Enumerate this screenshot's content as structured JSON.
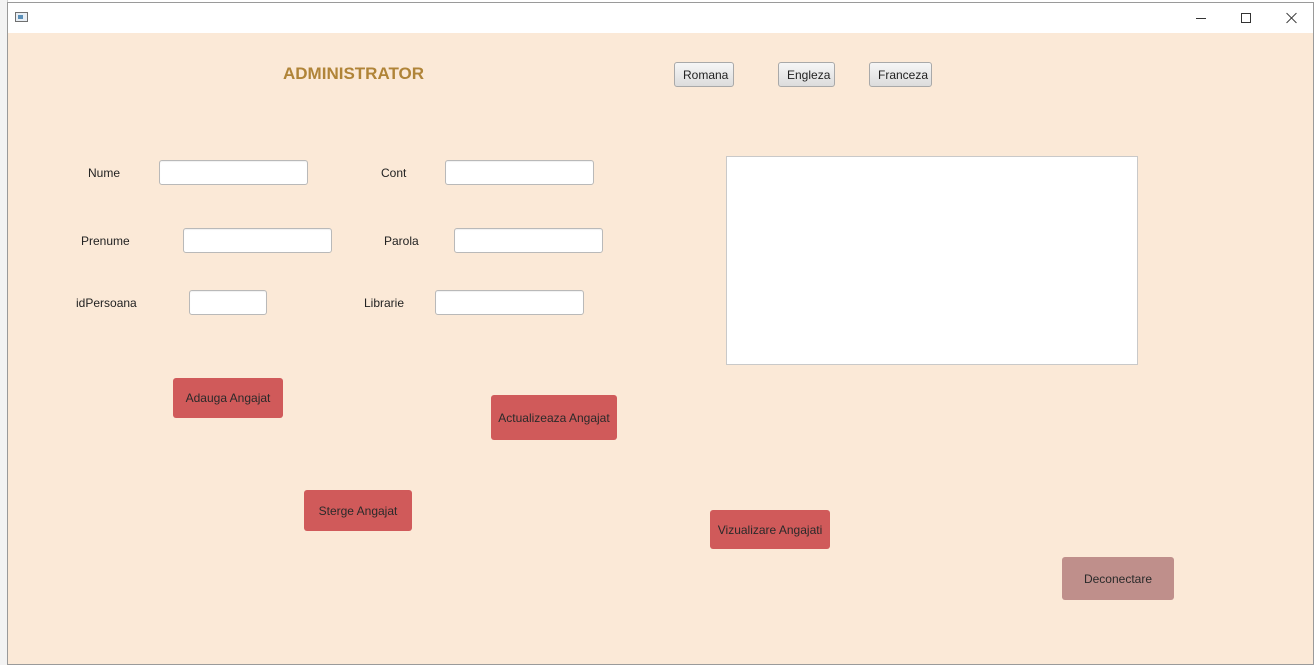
{
  "window": {
    "icon": "app-window-icon",
    "controls": {
      "minimize_icon": "minimize-icon",
      "maximize_icon": "maximize-icon",
      "close_icon": "close-icon"
    }
  },
  "header": {
    "title": "ADMINISTRATOR",
    "languages": [
      "Romana",
      "Engleza",
      "Franceza"
    ]
  },
  "form": {
    "nume_label": "Nume",
    "nume_value": "",
    "cont_label": "Cont",
    "cont_value": "",
    "prenume_label": "Prenume",
    "prenume_value": "",
    "parola_label": "Parola",
    "parola_value": "",
    "idpersoana_label": "idPersoana",
    "idpersoana_value": "",
    "librarie_label": "Librarie",
    "librarie_value": ""
  },
  "output": {
    "text": ""
  },
  "actions": {
    "adauga": "Adauga Angajat",
    "actualizeaza": "Actualizeaza Angajat",
    "sterge": "Sterge Angajat",
    "vizualizare": "Vizualizare Angajati",
    "deconectare": "Deconectare"
  },
  "colors": {
    "background": "#fbe9d7",
    "title": "#b08438",
    "action_button": "#d05a5a",
    "logout_button": "#bf8f8b"
  }
}
